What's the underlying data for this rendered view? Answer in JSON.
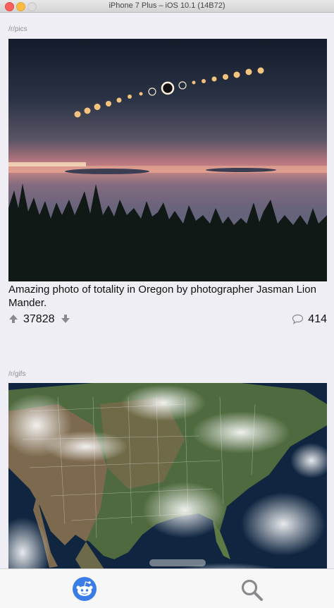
{
  "window": {
    "title": "iPhone 7 Plus – iOS 10.1 (14B72)"
  },
  "posts": [
    {
      "subreddit": "/r/pics",
      "title": "Amazing photo of totality in Oregon by photographer Jasman Lion Mander.",
      "score": "37828",
      "comments": "414",
      "image": "eclipse-sequence-over-forest-photo"
    },
    {
      "subreddit": "/r/gifs",
      "image": "satellite-view-of-north-america-gif"
    }
  ],
  "tabbar": {
    "tabs": [
      {
        "icon": "reddit-alien-icon",
        "active": true
      },
      {
        "icon": "search-icon",
        "active": false
      }
    ]
  },
  "colors": {
    "background": "#efeef4",
    "accent": "#3a7de8",
    "inactive_icon": "#8a8a8e"
  }
}
